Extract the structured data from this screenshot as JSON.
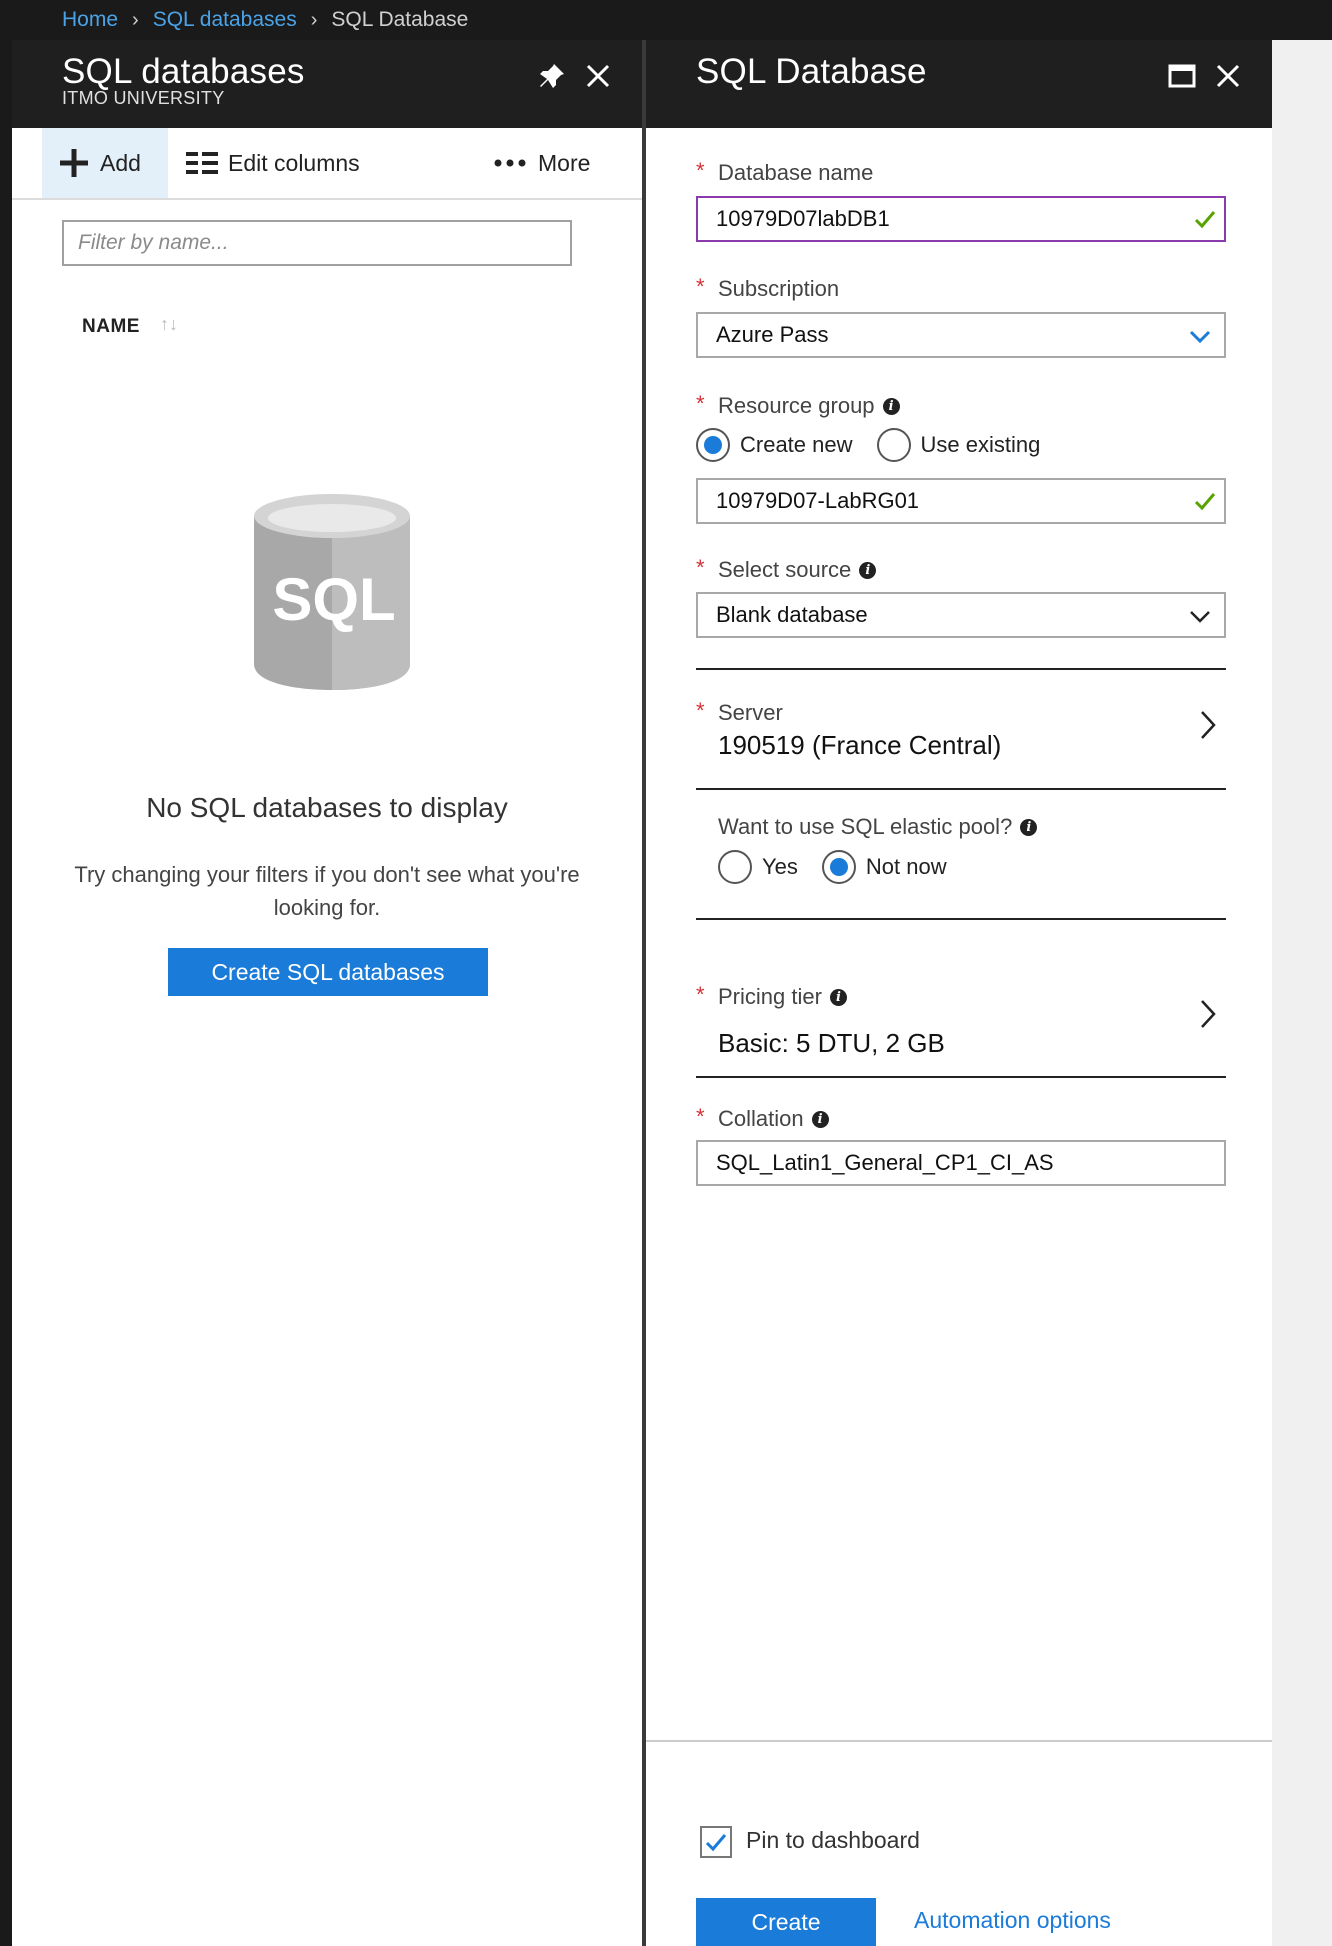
{
  "breadcrumb": {
    "items": [
      "Home",
      "SQL databases"
    ],
    "current": "SQL Database"
  },
  "left_blade": {
    "title": "SQL databases",
    "subtitle": "ITMO UNIVERSITY",
    "icons": {
      "pin": "pin-icon",
      "close": "close-icon"
    },
    "toolbar": {
      "add_label": "Add",
      "edit_columns_label": "Edit columns",
      "more_label": "More"
    },
    "filter": {
      "placeholder": "Filter by name..."
    },
    "column_header": "NAME",
    "empty_state": {
      "icon_text": "SQL",
      "title": "No SQL databases to display",
      "description": "Try changing your filters if you don't see what you're looking for.",
      "button_label": "Create SQL databases"
    }
  },
  "right_blade": {
    "title": "SQL Database",
    "icons": {
      "maximize": "maximize-icon",
      "close": "close-icon"
    },
    "form": {
      "database_name": {
        "label": "Database name",
        "value": "10979D07labDB1"
      },
      "subscription": {
        "label": "Subscription",
        "value": "Azure Pass"
      },
      "resource_group": {
        "label": "Resource group",
        "options": [
          "Create new",
          "Use existing"
        ],
        "selected": "Create new",
        "value": "10979D07-LabRG01"
      },
      "select_source": {
        "label": "Select source",
        "value": "Blank database"
      },
      "server": {
        "label": "Server",
        "value": "190519 (France Central)"
      },
      "elastic_pool": {
        "label": "Want to use SQL elastic pool?",
        "options": [
          "Yes",
          "Not now"
        ],
        "selected": "Not now"
      },
      "pricing_tier": {
        "label": "Pricing tier",
        "value": "Basic: 5 DTU, 2 GB"
      },
      "collation": {
        "label": "Collation",
        "value": "SQL_Latin1_General_CP1_CI_AS"
      }
    },
    "footer": {
      "pin_label": "Pin to dashboard",
      "pin_checked": true,
      "create_label": "Create",
      "automation_label": "Automation options"
    }
  },
  "colors": {
    "accent": "#1a7bd8",
    "header_bg": "#1f1f1f",
    "required": "#d13438",
    "valid": "#57a300",
    "link": "#4aa3e8"
  }
}
